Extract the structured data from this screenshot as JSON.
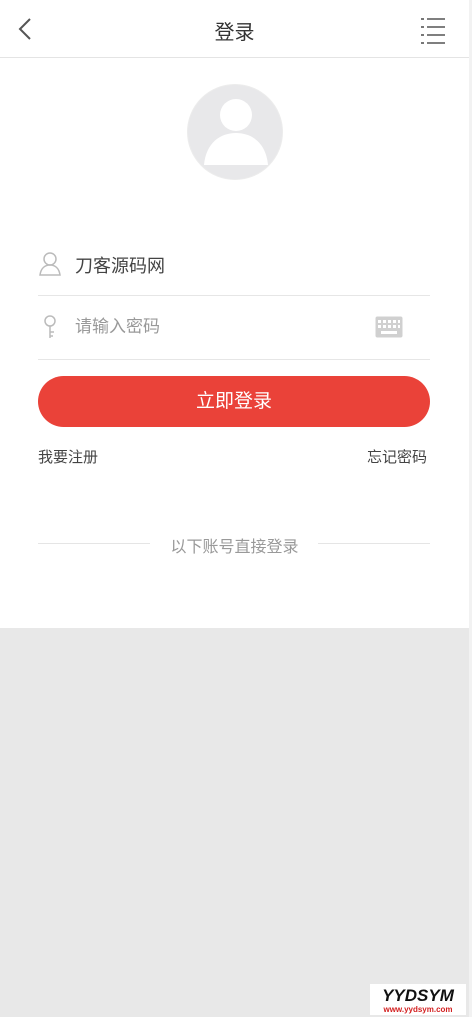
{
  "header": {
    "title": "登录",
    "back_icon": "chevron-left-icon",
    "menu_icon": "list-menu-icon"
  },
  "avatar": {
    "icon": "default-avatar-icon"
  },
  "form": {
    "username_value": "刀客源码网",
    "username_icon": "user-icon",
    "password_placeholder": "请输入密码",
    "password_icon": "key-icon",
    "keyboard_icon": "keyboard-icon"
  },
  "actions": {
    "login_label": "立即登录",
    "register_label": "我要注册",
    "forgot_label": "忘记密码"
  },
  "third_party": {
    "label": "以下账号直接登录"
  },
  "watermark": {
    "text": "YYDSYM",
    "subtext": "www.yydsym.com"
  },
  "colors": {
    "accent": "#ea4239",
    "background": "#e8e8e8",
    "text": "#333333",
    "muted": "#999999"
  }
}
